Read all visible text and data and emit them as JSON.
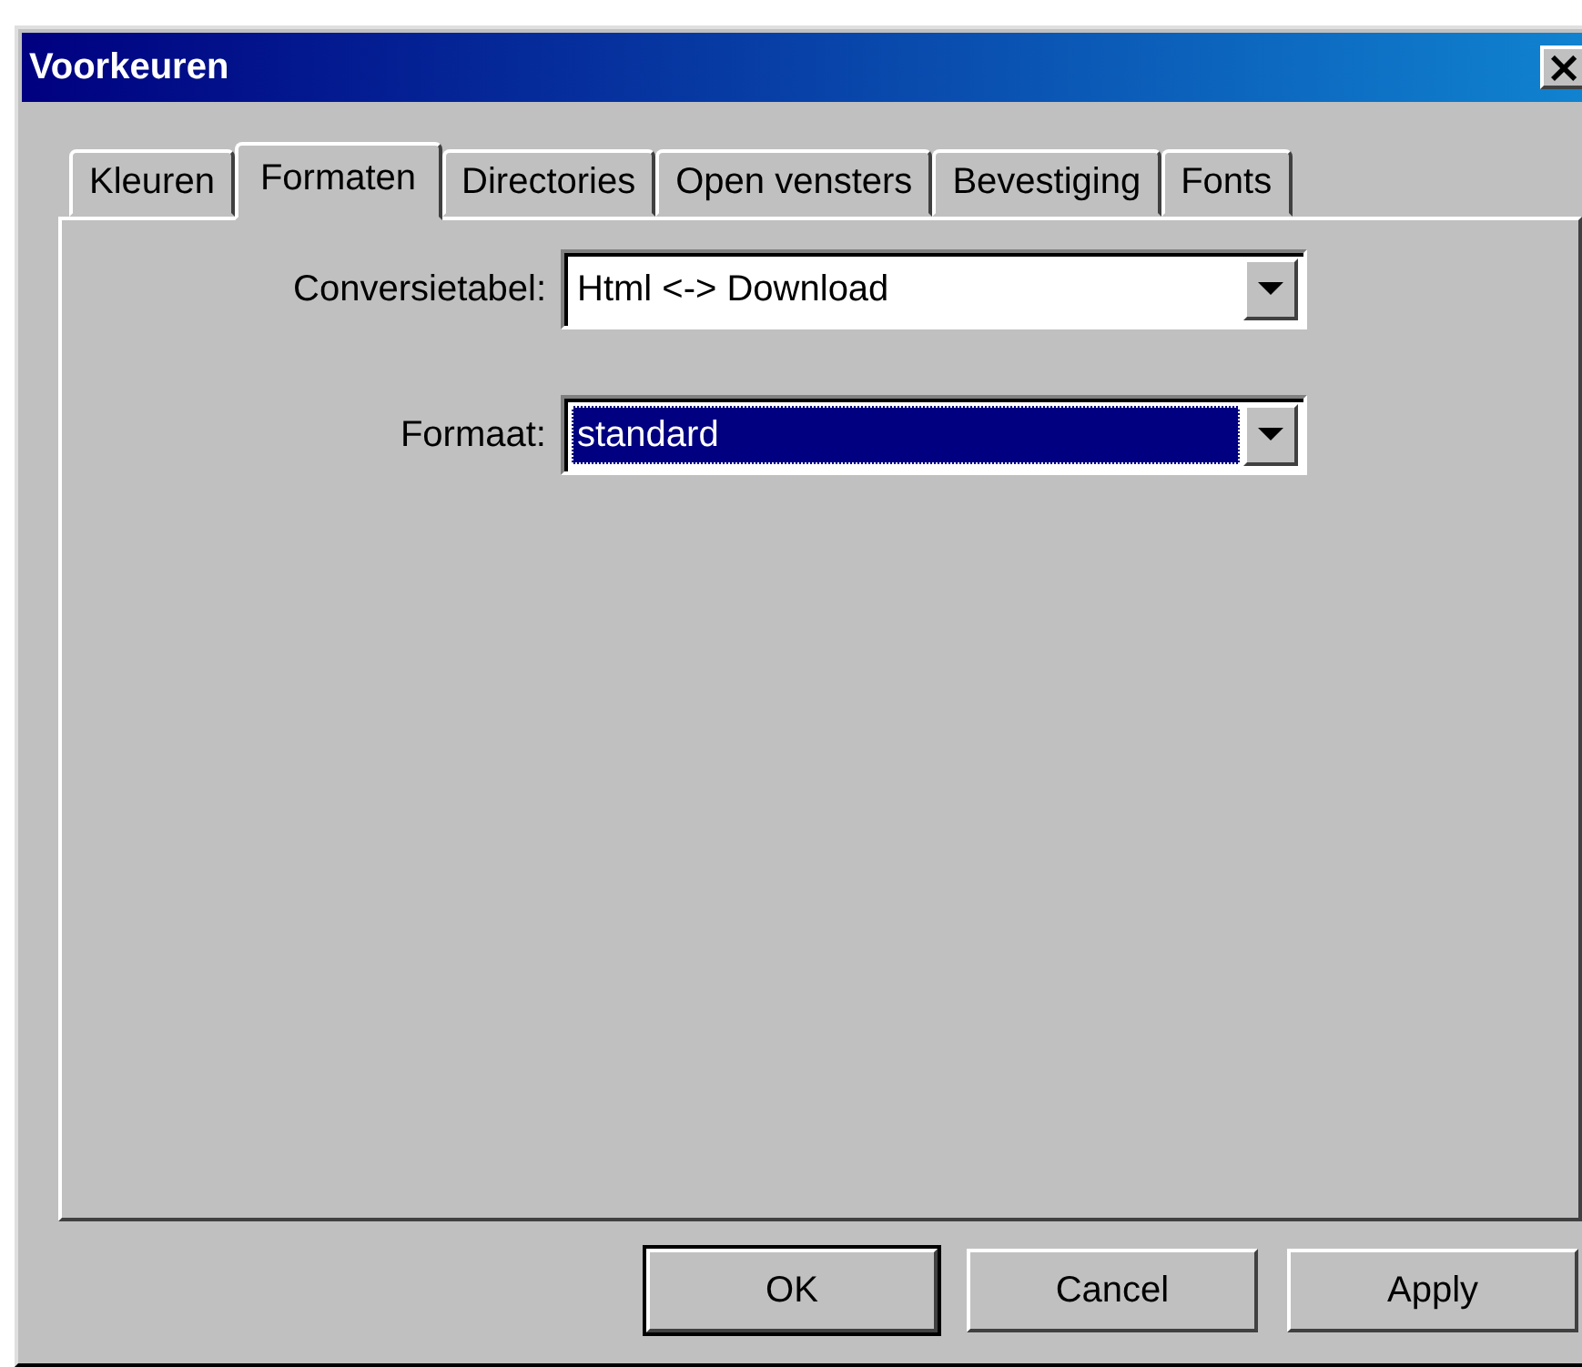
{
  "window": {
    "title": "Voorkeuren",
    "close": "×"
  },
  "tabs": [
    {
      "label": "Kleuren",
      "selected": false
    },
    {
      "label": "Formaten",
      "selected": true
    },
    {
      "label": "Directories",
      "selected": false
    },
    {
      "label": "Open vensters",
      "selected": false
    },
    {
      "label": "Bevestiging",
      "selected": false
    },
    {
      "label": "Fonts",
      "selected": false
    }
  ],
  "fields": [
    {
      "label": "Conversietabel:",
      "value": "Html <-> Download",
      "highlighted": false
    },
    {
      "label": "Formaat:",
      "value": "standard",
      "highlighted": true
    }
  ],
  "buttons": [
    {
      "label": "OK",
      "default": true
    },
    {
      "label": "Cancel",
      "default": false
    },
    {
      "label": "Apply",
      "default": false
    }
  ]
}
